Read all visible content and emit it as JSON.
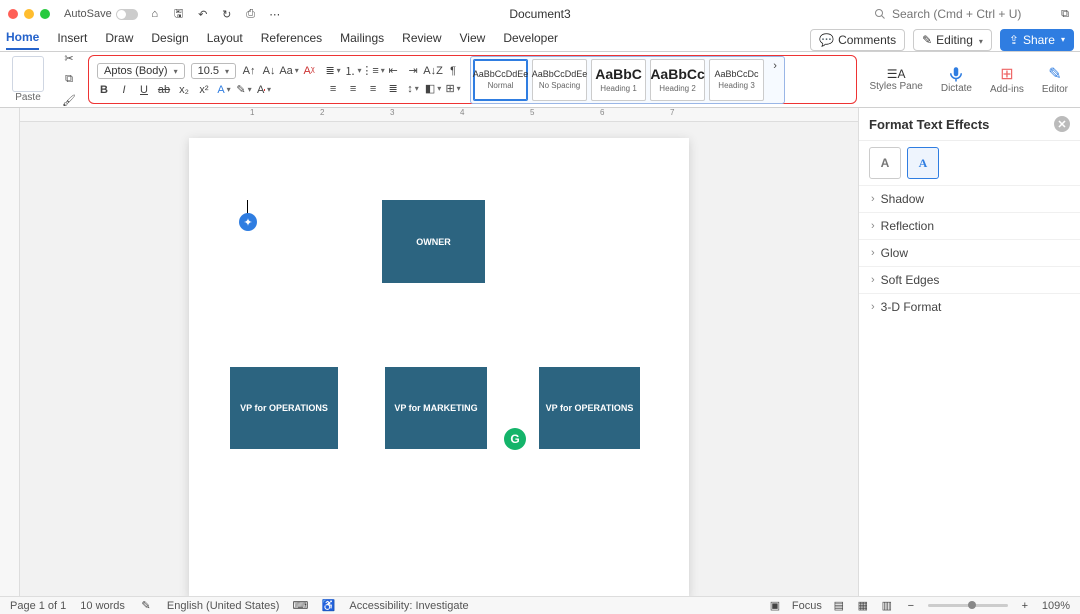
{
  "titlebar": {
    "autosave": "AutoSave",
    "doc": "Document3",
    "search_placeholder": "Search (Cmd + Ctrl + U)"
  },
  "tabs": {
    "home": "Home",
    "insert": "Insert",
    "draw": "Draw",
    "design": "Design",
    "layout": "Layout",
    "references": "References",
    "mailings": "Mailings",
    "review": "Review",
    "view": "View",
    "developer": "Developer"
  },
  "right_actions": {
    "comments": "Comments",
    "editing": "Editing",
    "share": "Share"
  },
  "ribbon": {
    "paste": "Paste",
    "font_name": "Aptos (Body)",
    "font_size": "10.5",
    "styles": [
      {
        "preview": "AaBbCcDdEe",
        "name": "Normal"
      },
      {
        "preview": "AaBbCcDdEe",
        "name": "No Spacing"
      },
      {
        "preview": "AaBbC",
        "name": "Heading 1"
      },
      {
        "preview": "AaBbCc",
        "name": "Heading 2"
      },
      {
        "preview": "AaBbCcDc",
        "name": "Heading 3"
      }
    ],
    "styles_pane": "Styles Pane",
    "dictate": "Dictate",
    "addins": "Add-ins",
    "editor": "Editor"
  },
  "shapes": {
    "owner": "OWNER",
    "vp_ops": "VP for OPERATIONS",
    "vp_mkt": "VP for MARKETING",
    "vp_ops2": "VP for OPERATIONS"
  },
  "sidepane": {
    "title": "Format Text Effects",
    "tab_a": "A",
    "tab_a2": "A",
    "shadow": "Shadow",
    "reflection": "Reflection",
    "glow": "Glow",
    "soft": "Soft Edges",
    "threed": "3-D Format"
  },
  "status": {
    "page": "Page 1 of 1",
    "words": "10 words",
    "lang": "English (United States)",
    "acc": "Accessibility: Investigate",
    "focus": "Focus",
    "zoom": "109%"
  },
  "ruler_marks": [
    "1",
    "2",
    "3",
    "4",
    "5",
    "6",
    "7"
  ]
}
